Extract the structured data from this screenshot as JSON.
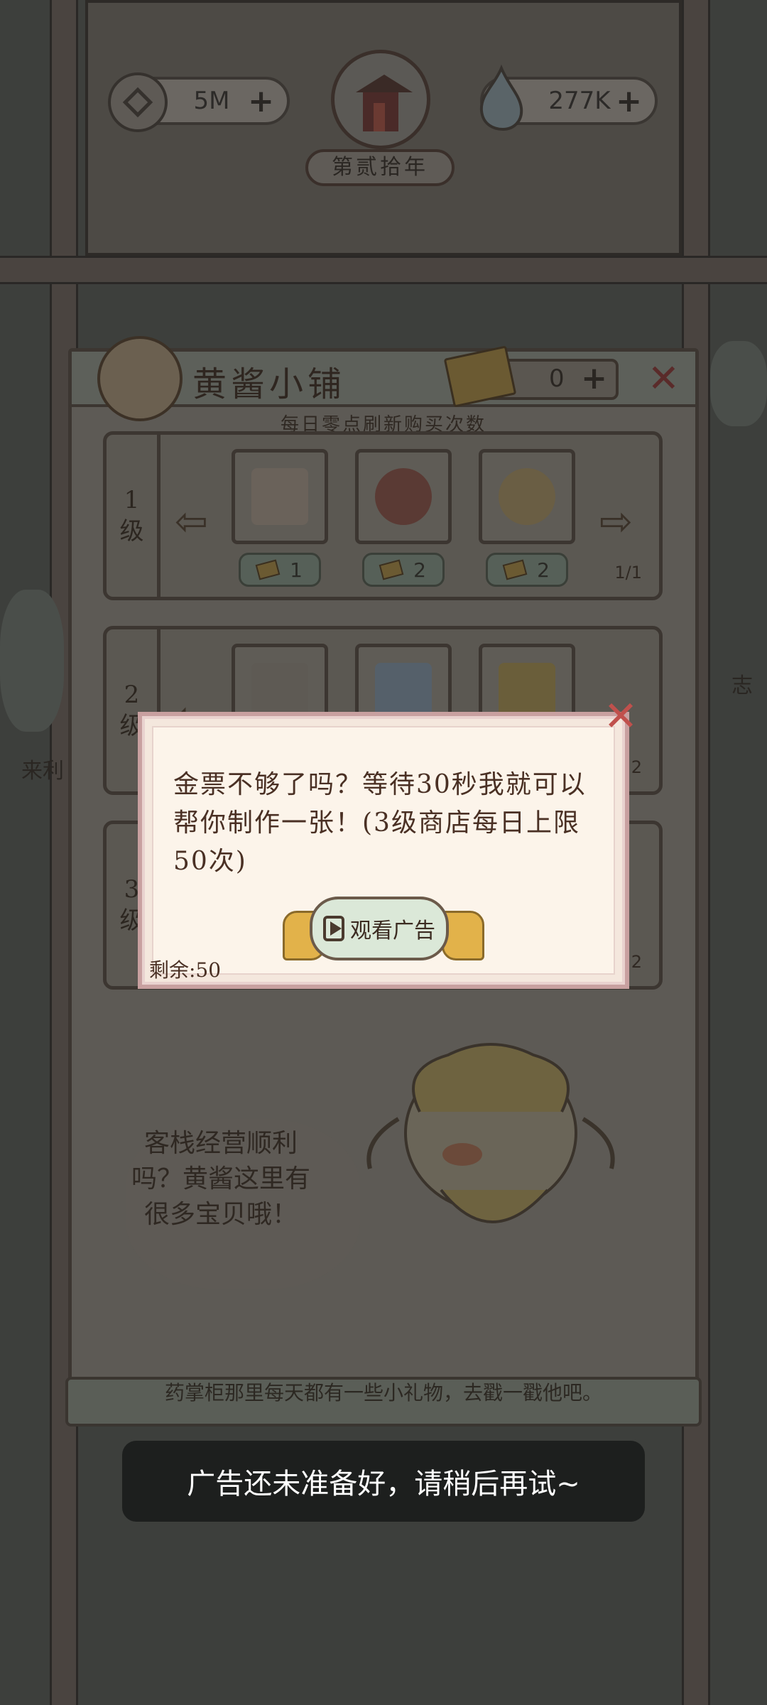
{
  "hud": {
    "coins": "5M",
    "spirit": "277K",
    "year": "第贰拾年",
    "plus": "+"
  },
  "shop": {
    "title": "黄酱小铺",
    "tickets": "0",
    "plus": "+",
    "close": "✕",
    "subtitle": "每日零点刷新购买次数",
    "tiers": [
      {
        "label_num": "1",
        "label_unit": "级",
        "prices": [
          "1",
          "2",
          "2"
        ],
        "page": "1/1"
      },
      {
        "label_num": "2",
        "label_unit": "级",
        "page": "2"
      },
      {
        "label_num": "3",
        "label_unit": "级",
        "page": "2"
      }
    ],
    "speech": "客栈经营顺利吗？黄酱这里有很多宝贝哦！",
    "footer_tip": "药掌柜那里每天都有一些小礼物，去戳一戳他吧。"
  },
  "dialog": {
    "message": "金票不够了吗？等待30秒我就可以帮你制作一张！(3级商店每日上限50次)",
    "watch_label": "观看广告",
    "remaining": "剩余:50",
    "close": "✕"
  },
  "toast": {
    "message": "广告还未准备好，请稍后再试~"
  },
  "side_labels": {
    "left": "来利",
    "right": "志"
  }
}
